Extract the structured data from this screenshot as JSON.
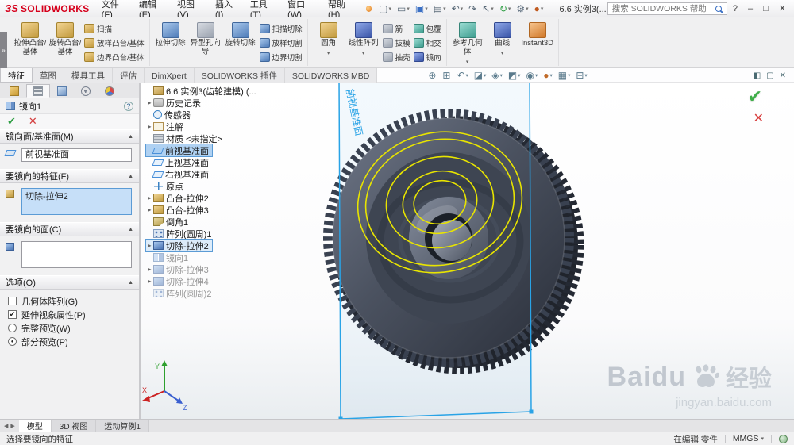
{
  "titlebar": {
    "brand_mark": "ЗS",
    "brand": "SOLIDWORKS",
    "menus": [
      "文件(F)",
      "编辑(E)",
      "视图(V)",
      "插入(I)",
      "工具(T)",
      "窗口(W)",
      "帮助(H)"
    ],
    "quick_tools": [
      {
        "name": "new-document",
        "glyph": "▢",
        "caret": "▾"
      },
      {
        "name": "open-document",
        "glyph": "▭",
        "caret": "▾"
      },
      {
        "name": "save",
        "glyph": "▣",
        "caret": "▾"
      },
      {
        "name": "print",
        "glyph": "▤",
        "caret": "▾"
      },
      {
        "name": "undo",
        "glyph": "↶",
        "caret": "▾"
      },
      {
        "name": "redo",
        "glyph": "↷",
        "caret": ""
      },
      {
        "name": "select",
        "glyph": "↖",
        "caret": "▾"
      },
      {
        "name": "rebuild",
        "glyph": "↻",
        "caret": "▾"
      },
      {
        "name": "options",
        "glyph": "⚙",
        "caret": "▾"
      },
      {
        "name": "edit-appearance",
        "glyph": "●",
        "caret": "▾"
      }
    ],
    "document_title": "6.6 实例3(...",
    "search_placeholder": "搜索 SOLIDWORKS 帮助",
    "window_controls": {
      "help": "?",
      "minimize": "–",
      "restore": "□",
      "close": "✕"
    }
  },
  "ribbon": {
    "tabs": [
      {
        "label": "特征",
        "active": true
      },
      {
        "label": "草图"
      },
      {
        "label": "模具工具"
      },
      {
        "label": "评估"
      },
      {
        "label": "DimXpert"
      },
      {
        "label": "SOLIDWORKS 插件"
      },
      {
        "label": "SOLIDWORKS MBD"
      }
    ],
    "groups": [
      {
        "big": [
          {
            "label": "拉伸凸台/基体"
          },
          {
            "label": "旋转凸台/基体"
          }
        ],
        "small": [
          {
            "label": "扫描"
          },
          {
            "label": "放样凸台/基体"
          },
          {
            "label": "边界凸台/基体"
          }
        ]
      },
      {
        "big": [
          {
            "label": "拉伸切除"
          },
          {
            "label": "异型孔向导"
          },
          {
            "label": "旋转切除"
          }
        ],
        "small": [
          {
            "label": "扫描切除"
          },
          {
            "label": "放样切割"
          },
          {
            "label": "边界切割"
          }
        ]
      },
      {
        "big": [
          {
            "label": "圆角",
            "caret": "▾"
          },
          {
            "label": "线性阵列",
            "caret": "▾"
          }
        ],
        "small": [
          {
            "label": "筋"
          },
          {
            "label": "拔模"
          },
          {
            "label": "抽壳"
          }
        ],
        "small2": [
          {
            "label": "包覆"
          },
          {
            "label": "相交"
          },
          {
            "label": "镜向"
          }
        ]
      },
      {
        "big": [
          {
            "label": "参考几何体",
            "caret": "▾"
          },
          {
            "label": "曲线",
            "caret": "▾"
          },
          {
            "label": "Instant3D"
          }
        ]
      }
    ]
  },
  "headsup": {
    "icons": [
      {
        "name": "zoom-fit",
        "glyph": "⊕",
        "caret": ""
      },
      {
        "name": "zoom-area",
        "glyph": "⊞",
        "caret": ""
      },
      {
        "name": "previous-view",
        "glyph": "↶",
        "caret": "▾"
      },
      {
        "name": "section-view",
        "glyph": "◪",
        "caret": "▾"
      },
      {
        "name": "view-orientation",
        "glyph": "◈",
        "caret": "▾"
      },
      {
        "name": "display-style",
        "glyph": "◩",
        "caret": "▾"
      },
      {
        "name": "hide-show-items",
        "glyph": "◉",
        "caret": "▾"
      },
      {
        "name": "edit-appearance",
        "glyph": "●",
        "caret": "▾"
      },
      {
        "name": "apply-scene",
        "glyph": "▦",
        "caret": "▾"
      },
      {
        "name": "view-settings",
        "glyph": "⊟",
        "caret": "▾"
      }
    ]
  },
  "pane_controls": [
    {
      "name": "pane-split",
      "glyph": "◧"
    },
    {
      "name": "pane-window",
      "glyph": "▢"
    },
    {
      "name": "pane-close",
      "glyph": "✕"
    }
  ],
  "pm": {
    "title": "镜向1",
    "help": "?",
    "confirm_ok": "✔",
    "confirm_cancel": "✕",
    "groups": {
      "mirror_plane": {
        "label": "镜向面/基准面(M)",
        "value": "前视基准面"
      },
      "features": {
        "label": "要镜向的特征(F)",
        "value": "切除-拉伸2"
      },
      "faces": {
        "label": "要镜向的面(C)",
        "value": ""
      },
      "options": {
        "label": "选项(O)",
        "items": [
          {
            "type": "checkbox",
            "label": "几何体阵列(G)",
            "mark": ""
          },
          {
            "type": "checkbox",
            "label": "延伸视象属性(P)",
            "mark": "✔"
          },
          {
            "type": "radio",
            "label": "完整预览(W)",
            "mark": ""
          },
          {
            "type": "radio",
            "label": "部分预览(P)",
            "mark": "●"
          }
        ]
      }
    }
  },
  "tree": {
    "items": [
      {
        "label": "6.6 实例3(齿轮建模) (...",
        "icon": "part",
        "arrow": "",
        "state": "root"
      },
      {
        "label": "历史记录",
        "icon": "history",
        "arrow": "▸",
        "state": ""
      },
      {
        "label": "传感器",
        "icon": "sensors",
        "arrow": "",
        "state": ""
      },
      {
        "label": "注解",
        "icon": "annotations",
        "arrow": "▸",
        "state": ""
      },
      {
        "label": "材质 <未指定>",
        "icon": "material",
        "arrow": "",
        "state": ""
      },
      {
        "label": "前视基准面",
        "icon": "plane",
        "arrow": "",
        "state": "selected"
      },
      {
        "label": "上视基准面",
        "icon": "plane",
        "arrow": "",
        "state": ""
      },
      {
        "label": "右视基准面",
        "icon": "plane",
        "arrow": "",
        "state": ""
      },
      {
        "label": "原点",
        "icon": "origin",
        "arrow": "",
        "state": ""
      },
      {
        "label": "凸台-拉伸2",
        "icon": "boss",
        "arrow": "▸",
        "state": ""
      },
      {
        "label": "凸台-拉伸3",
        "icon": "boss",
        "arrow": "▸",
        "state": ""
      },
      {
        "label": "倒角1",
        "icon": "chamfer",
        "arrow": "",
        "state": ""
      },
      {
        "label": "阵列(圆周)1",
        "icon": "pattern",
        "arrow": "",
        "state": ""
      },
      {
        "label": "切除-拉伸2",
        "icon": "cut",
        "arrow": "▸",
        "state": "boxed"
      },
      {
        "label": "镜向1",
        "icon": "mirror",
        "arrow": "",
        "state": "disabled"
      },
      {
        "label": "切除-拉伸3",
        "icon": "cut",
        "arrow": "▸",
        "state": "disabled"
      },
      {
        "label": "切除-拉伸4",
        "icon": "cut",
        "arrow": "▸",
        "state": "disabled"
      },
      {
        "label": "阵列(圆周)2",
        "icon": "pattern",
        "arrow": "",
        "state": "disabled"
      }
    ]
  },
  "viewport": {
    "plane_label": "前视基准面",
    "confirm_ok": "✔",
    "confirm_cancel": "✕",
    "axis_x": "X",
    "axis_y": "Y",
    "axis_z": "Z",
    "accent_blue": "#29a3e6",
    "preview_yellow": "#e8e400"
  },
  "bottom_tabs": {
    "nav_prev": "◀",
    "nav_next": "▶",
    "items": [
      {
        "label": "模型",
        "active": true
      },
      {
        "label": "3D 视图"
      },
      {
        "label": "运动算例1"
      }
    ]
  },
  "statusbar": {
    "message": "选择要镜向的特征",
    "edit_mode": "在编辑 零件",
    "units": "MMGS",
    "units_caret": "▾"
  },
  "watermark": {
    "brand": "Baidu",
    "suffix": "经验",
    "url": "jingyan.baidu.com"
  },
  "flyout_glyph": "»"
}
